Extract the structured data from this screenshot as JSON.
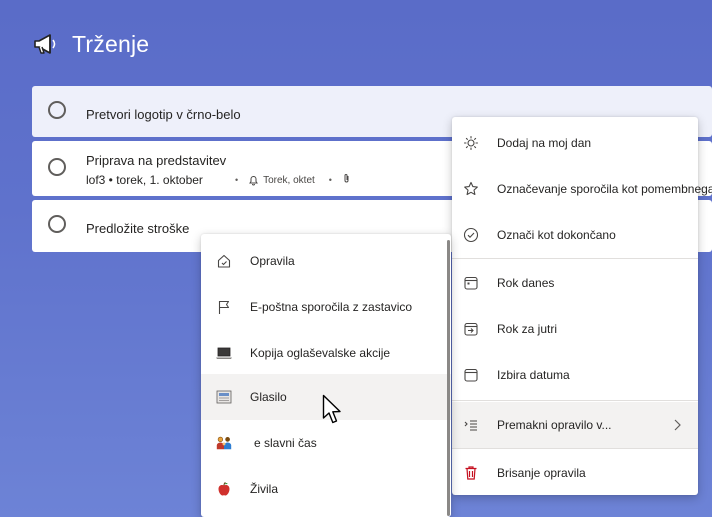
{
  "header": {
    "title": "Trženje",
    "icon": "megaphone-icon"
  },
  "tasks": [
    {
      "title": "Pretvori logotip v črno-belo"
    },
    {
      "title": "Priprava na predstavitev",
      "meta_text": "lof3 • torek, 1. oktober",
      "reminder": "Torek, oktet"
    },
    {
      "title": "Predložite stroške"
    }
  ],
  "context_menu": {
    "items": [
      {
        "label": "Dodaj na moj dan",
        "icon": "sun-icon"
      },
      {
        "label": "Označevanje sporočila kot pomembnega",
        "icon": "star-icon"
      },
      {
        "label": "Označi kot dokončano",
        "icon": "check-circle-icon"
      },
      {
        "label": "Rok danes",
        "icon": "calendar-today-icon"
      },
      {
        "label": "Rok za jutri",
        "icon": "calendar-tomorrow-icon"
      },
      {
        "label": "Izbira datuma",
        "icon": "calendar-pick-icon"
      },
      {
        "label": "Premakni opravilo v...",
        "icon": "move-list-icon"
      },
      {
        "label": "Brisanje opravila",
        "icon": "trash-icon"
      }
    ]
  },
  "list_submenu": {
    "items": [
      {
        "label": "Opravila",
        "icon": "home-icon"
      },
      {
        "label": "E-poštna sporočila z zastavico",
        "icon": "flag-icon"
      },
      {
        "label": "Kopija oglaševalske akcije",
        "icon": "laptop-icon"
      },
      {
        "label": "Glasilo",
        "icon": "newspaper-icon"
      },
      {
        "label": "e slavni čas",
        "icon": "family-icon"
      },
      {
        "label": "Živila",
        "icon": "apple-icon"
      }
    ]
  },
  "colors": {
    "accent": "#5f72cc",
    "delete": "#c50f1f"
  }
}
